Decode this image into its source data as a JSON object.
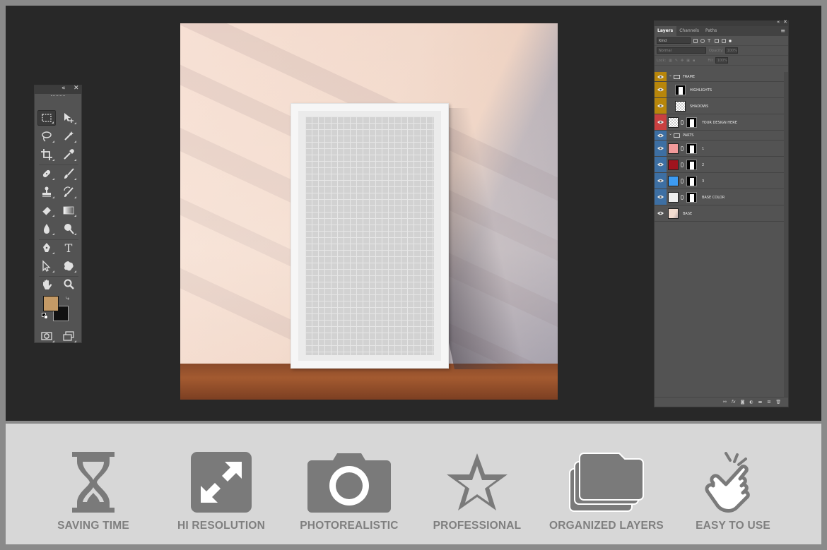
{
  "toolbox": {
    "collapse_glyph": "«",
    "close_glyph": "✕",
    "foreground_color": "#c49a66",
    "background_color": "#111111",
    "tools": [
      {
        "name": "rectangular-marquee-icon",
        "active": true
      },
      {
        "name": "move-icon"
      },
      {
        "name": "lasso-icon"
      },
      {
        "name": "magic-wand-icon"
      },
      {
        "name": "crop-icon"
      },
      {
        "name": "eyedropper-icon"
      },
      {
        "name": "healing-brush-icon"
      },
      {
        "name": "brush-icon"
      },
      {
        "name": "clone-stamp-icon"
      },
      {
        "name": "history-brush-icon"
      },
      {
        "name": "eraser-icon"
      },
      {
        "name": "gradient-icon"
      },
      {
        "name": "blur-icon"
      },
      {
        "name": "dodge-icon"
      },
      {
        "name": "pen-icon"
      },
      {
        "name": "type-icon"
      },
      {
        "name": "path-selection-icon"
      },
      {
        "name": "custom-shape-icon"
      },
      {
        "name": "hand-icon"
      },
      {
        "name": "zoom-icon"
      },
      {
        "name": "quick-mask-icon"
      },
      {
        "name": "screen-mode-icon"
      }
    ]
  },
  "layers_panel": {
    "collapse_glyph": "«",
    "close_glyph": "✕",
    "tabs": [
      "Layers",
      "Channels",
      "Paths"
    ],
    "active_tab": "Layers",
    "menu_glyph": "≡",
    "filter_kind": "Kind",
    "blend_mode": "Normal",
    "opacity_label": "Opacity:",
    "opacity_value": "100%",
    "lock_label": "Lock:",
    "fill_label": "Fill:",
    "fill_value": "100%",
    "layers": [
      {
        "name": "FRAME",
        "type": "group",
        "color": "#b8860b"
      },
      {
        "name": "HIGHLIGHTS",
        "type": "layer",
        "color": "#b8860b"
      },
      {
        "name": "SHADOWS",
        "type": "layer",
        "color": "#b8860b"
      },
      {
        "name": "YOUR DESIGN HERE",
        "type": "smart",
        "color": "#c94040"
      },
      {
        "name": "PARTS",
        "type": "group",
        "color": "#3d6fa3"
      },
      {
        "name": "1",
        "type": "fill",
        "color": "#3d6fa3",
        "swatch": "#f29a9a"
      },
      {
        "name": "2",
        "type": "fill",
        "color": "#3d6fa3",
        "swatch": "#a0141e"
      },
      {
        "name": "3",
        "type": "fill",
        "color": "#3d6fa3",
        "swatch": "#3d9bf2"
      },
      {
        "name": "BASE COLOR",
        "type": "fill",
        "color": "#3d6fa3",
        "swatch": "#eeeeee"
      },
      {
        "name": "BASE",
        "type": "image",
        "color": "#535353"
      }
    ],
    "footer_icons": [
      "link-icon",
      "fx-icon",
      "add-mask-icon",
      "adjustment-icon",
      "new-group-icon",
      "new-layer-icon",
      "trash-icon"
    ]
  },
  "features": [
    {
      "icon": "hourglass-icon",
      "label": "SAVING TIME"
    },
    {
      "icon": "expand-icon",
      "label": "HI RESOLUTION"
    },
    {
      "icon": "camera-icon",
      "label": "PHOTOREALISTIC"
    },
    {
      "icon": "star-icon",
      "label": "PROFESSIONAL"
    },
    {
      "icon": "stacked-folders-icon",
      "label": "ORGANIZED LAYERS"
    },
    {
      "icon": "tap-hand-icon",
      "label": "EASY TO USE"
    }
  ],
  "colors": {
    "feature_icon": "#7a7a7a",
    "feature_label": "#7f7f7f",
    "workspace": "#282828",
    "band": "#d7d7d7"
  }
}
